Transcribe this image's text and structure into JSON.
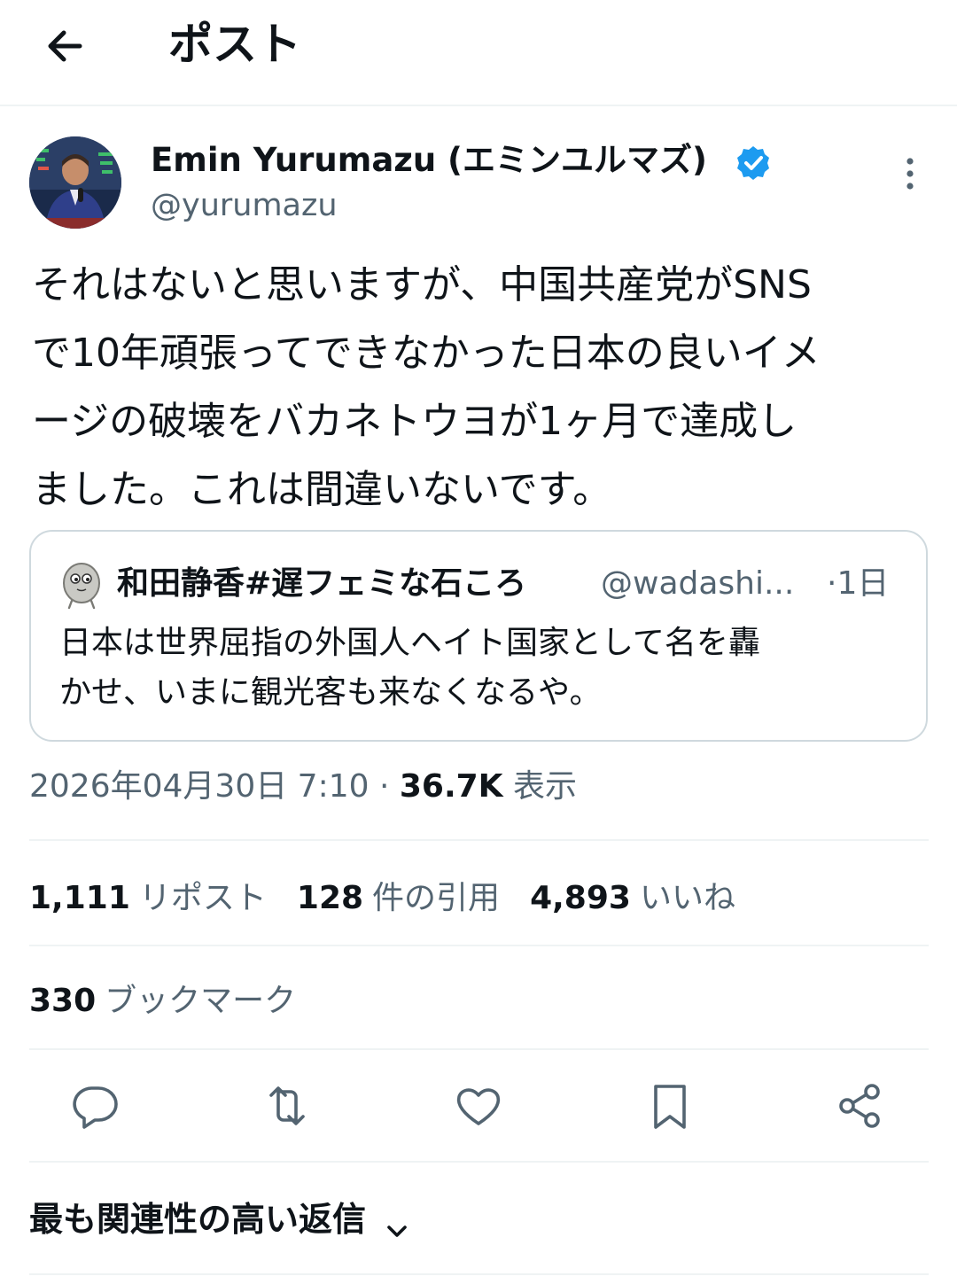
{
  "header": {
    "title": "ポスト"
  },
  "author": {
    "name": "Emin Yurumazu (エミンユルマズ)",
    "handle": "@yurumazu"
  },
  "tweet": {
    "lines": [
      "それはないと思いますが、中国共産党がSNS",
      "で10年頑張ってできなかった日本の良いイメ",
      "ージの破壊をバカネトウヨが1ヶ月で達成し",
      "ました。これは間違いないです。"
    ]
  },
  "quote": {
    "name": "和田静香#遅フェミな石ころ",
    "handle": "@wadashi...",
    "time": "·1日",
    "lines": [
      "日本は世界屈指の外国人ヘイト国家として名を轟",
      "かせ、いまに観光客も来なくなるや。"
    ]
  },
  "meta": {
    "datetime": "2026年04月30日 7:10 · ",
    "views_count": "36.7K",
    "views_label": " 表示"
  },
  "stats": {
    "reposts_count": "1,111",
    "reposts_label": "リポスト",
    "quotes_count": "128",
    "quotes_label": "件の引用",
    "likes_count": "4,893",
    "likes_label": "いいね",
    "bookmarks_count": "330",
    "bookmarks_label": "ブックマーク"
  },
  "replies": {
    "sort_label": "最も関連性の高い返信"
  },
  "colors": {
    "text": "#0f1419",
    "secondary": "#536471",
    "border": "#cfd9de",
    "divider": "#eff3f4",
    "verified": "#1d9bf0"
  },
  "icons": [
    "back-arrow-icon",
    "verified-badge-icon",
    "more-icon",
    "reply-icon",
    "repost-icon",
    "like-icon",
    "bookmark-icon",
    "share-icon",
    "chevron-down-icon"
  ]
}
